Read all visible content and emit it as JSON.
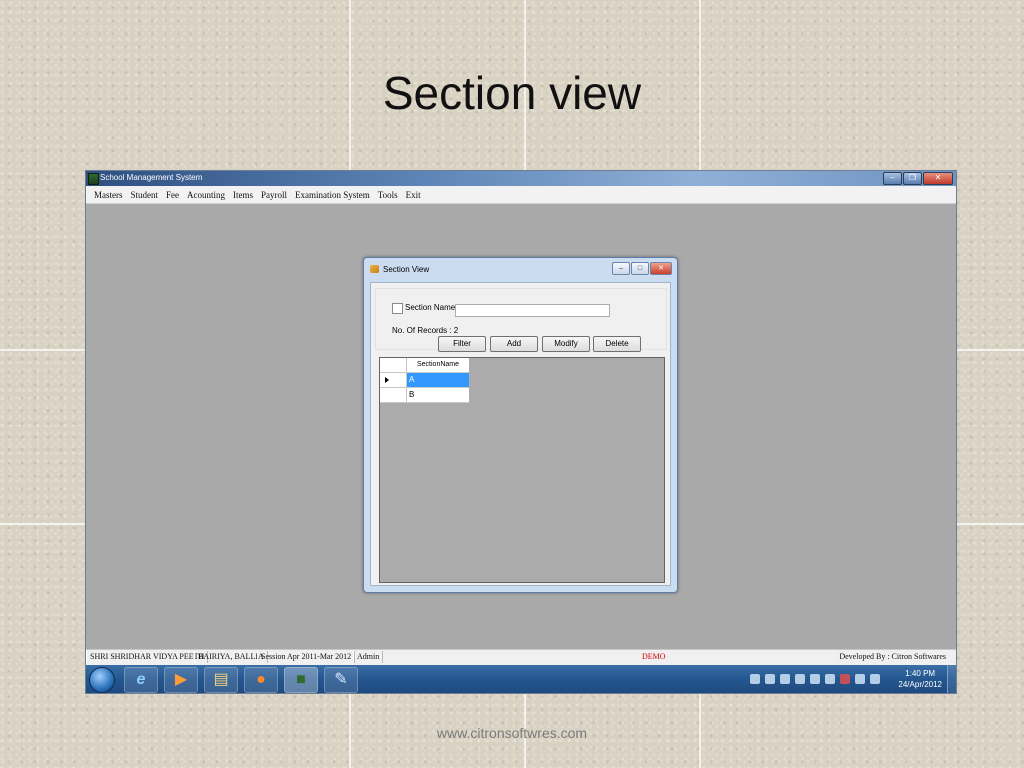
{
  "slide": {
    "title": "Section view",
    "footer_url": "www.citronsoftwres.com"
  },
  "app": {
    "title": "School Management System",
    "window_controls": [
      "minimize",
      "restore",
      "close"
    ],
    "menu": [
      "Masters",
      "Student",
      "Fee",
      "Acounting",
      "Items",
      "Payroll",
      "Examination System",
      "Tools",
      "Exit"
    ],
    "status": {
      "school": "SHRI SHRIDHAR VIDYA PEETH",
      "location": "BAIRIYA, BALLIA",
      "session": "Session Apr 2011-Mar 2012",
      "user": "Admin",
      "mode": "DEMO",
      "developer": "Developed By : Citron Softwares"
    },
    "taskbar": {
      "icons": [
        "windows-start-icon",
        "internet-explorer-icon",
        "media-player-icon",
        "file-explorer-icon",
        "firefox-icon",
        "school-app-icon",
        "paint-icon"
      ],
      "time": "1:40 PM",
      "date": "24/Apr/2012"
    },
    "colors": {
      "demo_text": "#d00000",
      "selection": "#3399ff"
    }
  },
  "dialog": {
    "title": "Section View",
    "checkbox_label": "Section Name",
    "checkbox_checked": false,
    "section_name_value": "",
    "records_label": "No. Of Records : 2",
    "buttons": {
      "filter": "Filter",
      "add": "Add",
      "modify": "Modify",
      "delete": "Delete"
    },
    "grid": {
      "columns": [
        "SectionName"
      ],
      "rows": [
        {
          "SectionName": "A",
          "selected": true
        },
        {
          "SectionName": "B",
          "selected": false
        }
      ]
    }
  }
}
